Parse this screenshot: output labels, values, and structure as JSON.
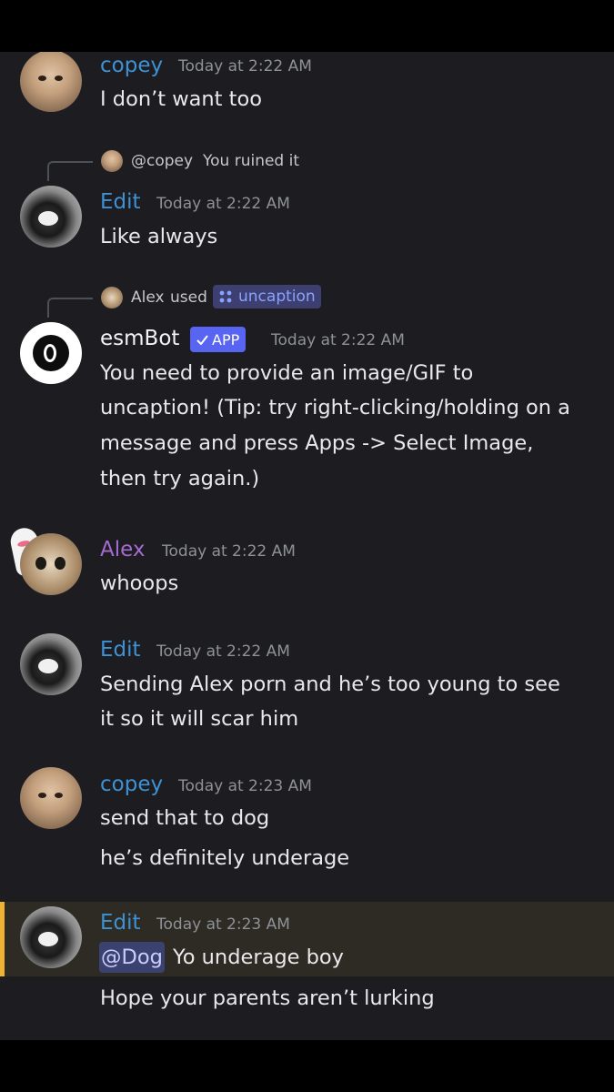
{
  "messages": [
    {
      "author": "copey",
      "time": "Today at 2:22 AM",
      "lines": [
        "I don’t want too"
      ]
    },
    {
      "reply": {
        "mention": "@copey",
        "text": "You ruined it"
      },
      "author": "Edit",
      "time": "Today at 2:22 AM",
      "lines": [
        "Like always"
      ]
    },
    {
      "command": {
        "user": "Alex",
        "used": "used",
        "name": "uncaption"
      },
      "author": "esmBot",
      "badge": "APP",
      "time": "Today at 2:22 AM",
      "lines": [
        "You need to provide an image/GIF to",
        "uncaption! (Tip: try right-clicking/holding on a",
        "message and press Apps -> Select Image,",
        "then try again.)"
      ]
    },
    {
      "author": "Alex",
      "time": "Today at 2:22 AM",
      "lines": [
        "whoops"
      ]
    },
    {
      "author": "Edit",
      "time": "Today at 2:22 AM",
      "lines": [
        "Sending Alex porn and he’s too young to see",
        "it so it will scar him"
      ]
    },
    {
      "author": "copey",
      "time": "Today at 2:23 AM",
      "lines": [
        "send that to dog",
        "he’s definitely underage"
      ]
    },
    {
      "author": "Edit",
      "time": "Today at 2:23 AM",
      "mention": "@Dog",
      "lines": [
        "Yo underage boy",
        "Hope your parents aren’t lurking"
      ]
    }
  ],
  "colors": {
    "background": "#1c1c21",
    "link_name": "#3e92d4",
    "alex_name": "#a56bd0",
    "mention_highlight": "#f0b232",
    "app_badge": "#5865f2"
  },
  "icons": [
    "cat-avatar",
    "dog-avatar",
    "esmbot-avatar",
    "kitten-avatar",
    "ghost-decoration",
    "checkmark-icon",
    "app-command-icon"
  ]
}
